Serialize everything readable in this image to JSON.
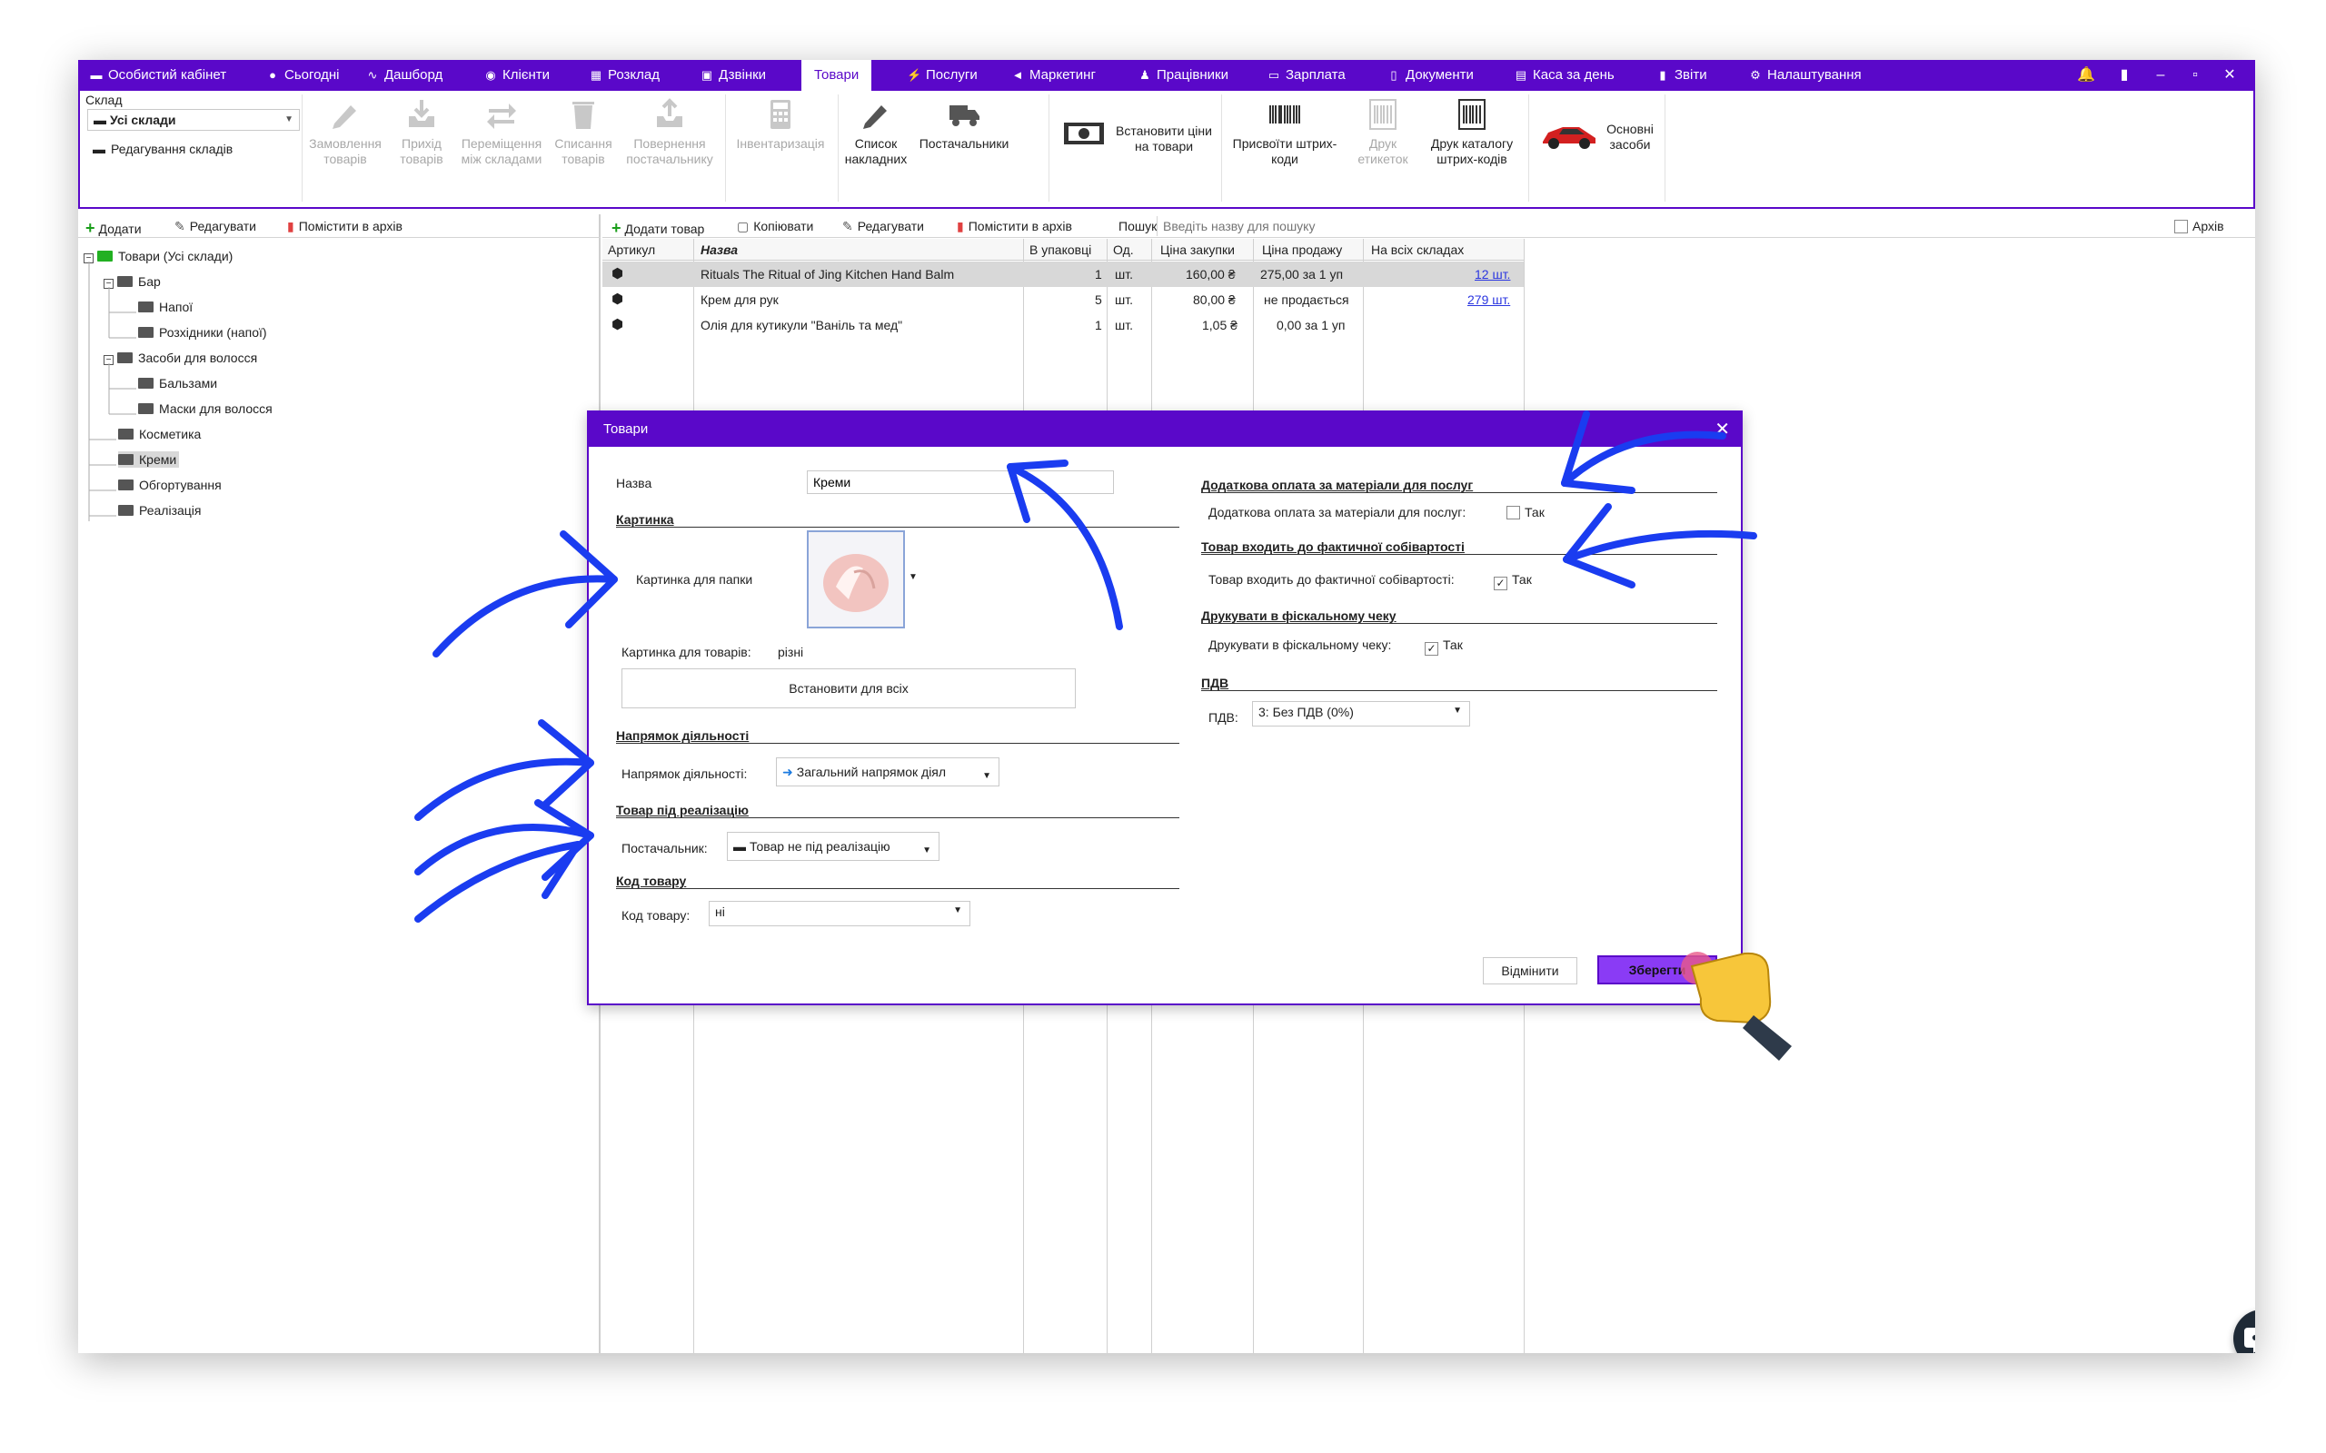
{
  "colors": {
    "accent": "#5a08c9",
    "primary_button": "#8a3bf5",
    "arrow": "#1a3cf0",
    "link": "#2a35e0",
    "chat": "#1f2a36"
  },
  "topnav": {
    "items": [
      {
        "label": "Особистий кабінет",
        "icon": "wallet-icon"
      },
      {
        "label": "Сьогодні",
        "icon": "clock-icon"
      },
      {
        "label": "Дашборд",
        "icon": "pulse-icon"
      },
      {
        "label": "Клієнти",
        "icon": "user-circle-icon"
      },
      {
        "label": "Розклад",
        "icon": "calendar-icon"
      },
      {
        "label": "Дзвінки",
        "icon": "phone-icon"
      },
      {
        "label": "Товари",
        "icon": ""
      },
      {
        "label": "Послуги",
        "icon": "bolt-icon"
      },
      {
        "label": "Маркетинг",
        "icon": "megaphone-icon"
      },
      {
        "label": "Працівники",
        "icon": "person-icon"
      },
      {
        "label": "Зарплата",
        "icon": "money-icon"
      },
      {
        "label": "Документи",
        "icon": "document-icon"
      },
      {
        "label": "Каса за день",
        "icon": "calculator-icon"
      },
      {
        "label": "Звіти",
        "icon": "bar-chart-icon"
      },
      {
        "label": "Налаштування",
        "icon": "gear-icon"
      }
    ]
  },
  "ribbon": {
    "warehouse_label": "Склад",
    "warehouse_value": "Усі склади",
    "edit_warehouses": "Редагування складів",
    "buttons": [
      {
        "label": "Замовлення товарів",
        "enabled": false
      },
      {
        "label": "Прихід товарів",
        "enabled": false
      },
      {
        "label": "Переміщення між складами",
        "enabled": false
      },
      {
        "label": "Списання товарів",
        "enabled": false
      },
      {
        "label": "Повернення постачальнику",
        "enabled": false
      },
      {
        "label": "Інвентаризація",
        "enabled": false
      },
      {
        "label": "Список накладних",
        "enabled": true
      },
      {
        "label": "Постачальники",
        "enabled": true
      },
      {
        "label": "Встановити ціни на товари",
        "enabled": true
      },
      {
        "label": "Присвоїти штрих-коди",
        "enabled": true
      },
      {
        "label": "Друк етикеток",
        "enabled": false
      },
      {
        "label": "Друк каталогу штрих-кодів",
        "enabled": true
      },
      {
        "label": "Основні засоби",
        "enabled": true
      }
    ]
  },
  "left_toolbar": {
    "add": "Додати",
    "edit": "Редагувати",
    "archive": "Помістити в архів"
  },
  "tree": [
    {
      "label": "Товари (Усі склади)",
      "level": 0
    },
    {
      "label": "Бар",
      "level": 1
    },
    {
      "label": "Напої",
      "level": 2
    },
    {
      "label": "Розхідники (напої)",
      "level": 2
    },
    {
      "label": "Засоби для волосся",
      "level": 1
    },
    {
      "label": "Бальзами",
      "level": 2
    },
    {
      "label": "Маски для волосся",
      "level": 2
    },
    {
      "label": "Косметика",
      "level": 1
    },
    {
      "label": "Креми",
      "level": 1,
      "selected": true
    },
    {
      "label": "Обгортування",
      "level": 1
    },
    {
      "label": "Реалізація",
      "level": 1
    }
  ],
  "right_toolbar": {
    "add": "Додати товар",
    "copy": "Копіювати",
    "edit": "Редагувати",
    "archive": "Помістити в архів",
    "search_label": "Пошук",
    "search_placeholder": "Введіть назву для пошуку",
    "archive_check": "Архів"
  },
  "grid": {
    "columns": [
      "Артикул",
      "Назва",
      "В упаковці",
      "Од.",
      "Ціна закупки",
      "Ціна продажу",
      "На всіх складах"
    ],
    "rows": [
      {
        "name": "Rituals The Ritual of Jing Kitchen Hand Balm",
        "pack": "1",
        "unit": "шт.",
        "buy": "160,00 ₴",
        "sell": "275,00 за 1 уп",
        "stock": "12 шт."
      },
      {
        "name": "Крем для рук",
        "pack": "5",
        "unit": "шт.",
        "buy": "80,00 ₴",
        "sell": "не продається",
        "stock": "279 шт."
      },
      {
        "name": "Олія для кутикули \"Ваніль та мед\"",
        "pack": "1",
        "unit": "шт.",
        "buy": "1,05 ₴",
        "sell": "0,00 за 1 уп",
        "stock": ""
      }
    ]
  },
  "dialog": {
    "title": "Товари",
    "name_label": "Назва",
    "name_value": "Креми",
    "picture_section": "Картинка",
    "folder_picture_label": "Картинка для папки",
    "goods_picture_label": "Картинка для товарів:",
    "goods_picture_value": "різні",
    "set_for_all": "Встановити для всіх",
    "direction_section": "Напрямок діяльності",
    "direction_label": "Напрямок діяльності:",
    "direction_value": "Загальний напрямок діял",
    "realization_section": "Товар під реалізацію",
    "supplier_label": "Постачальник:",
    "supplier_value": "Товар не під реалізацію",
    "code_section": "Код товару",
    "code_label": "Код товару:",
    "code_value": "ні",
    "extra_pay_section": "Додаткова оплата за матеріали для послуг",
    "extra_pay_label": "Додаткова оплата за матеріали для послуг:",
    "extra_pay_checked": false,
    "cost_section": "Товар входить до фактичної собівартості",
    "cost_label": "Товар входить до фактичної собівартості:",
    "cost_checked": true,
    "fiscal_section": "Друкувати в фіскальному чеку",
    "fiscal_label": "Друкувати в фіскальному чеку:",
    "fiscal_checked": true,
    "yes": "Так",
    "vat_section": "ПДВ",
    "vat_label": "ПДВ:",
    "vat_value": "3: Без ПДВ (0%)",
    "cancel": "Відмінити",
    "save": "Зберегти"
  }
}
